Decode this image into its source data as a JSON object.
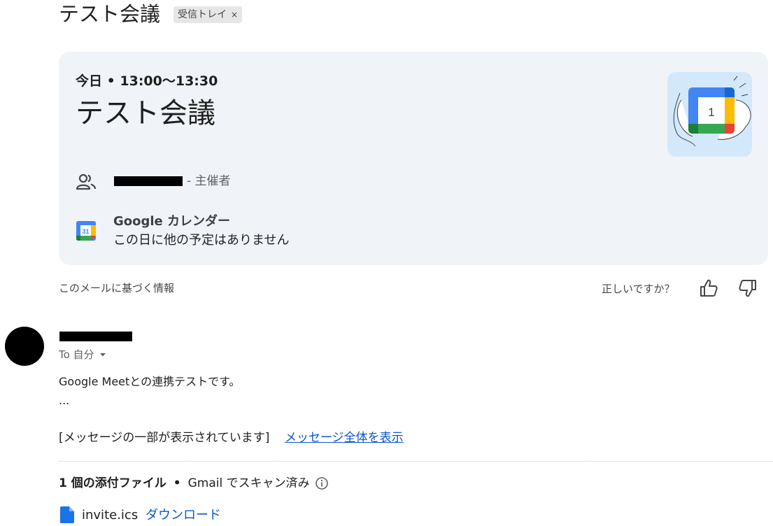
{
  "header": {
    "subject": "テスト会議",
    "label": "受信トレイ",
    "label_remove": "×"
  },
  "event": {
    "time": "今日 • 13:00〜13:30",
    "title": "テスト会議",
    "organizer_role": "- 主催者",
    "calendar_name": "Google カレンダー",
    "calendar_status": "この日に他の予定はありません",
    "calendar_icon_day": "31",
    "illustration_day": "1"
  },
  "info": {
    "label": "このメールに基づく情報",
    "feedback_question": "正しいですか？"
  },
  "message": {
    "to": "To 自分",
    "body": "Google Meetとの連携テストです。",
    "ellipsis": "...",
    "clipped_note": "[メッセージの一部が表示されています]",
    "view_full_link": "メッセージ全体を表示"
  },
  "attachments": {
    "count_label": "1 個の添付ファイル",
    "separator": "•",
    "scan_status": "Gmail でスキャン済み",
    "files": [
      {
        "name": "invite.ics",
        "action": "ダウンロード"
      }
    ]
  },
  "colors": {
    "card_bg": "#f0f4f9",
    "link": "#0b57d0",
    "illustration_bg": "#d3e8fb"
  }
}
